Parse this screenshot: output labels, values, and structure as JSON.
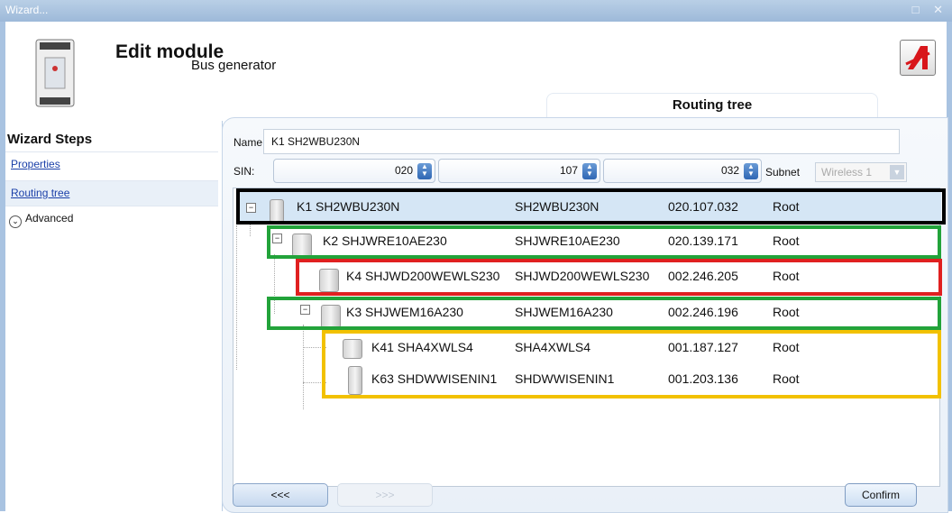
{
  "window": {
    "title": "Wizard...",
    "controls": "□ ✕"
  },
  "header": {
    "title": "Edit module",
    "subtitle": "Bus generator",
    "tab": "Routing tree"
  },
  "sidebar": {
    "title": "Wizard Steps",
    "items": [
      {
        "label": "Properties"
      },
      {
        "label": "Routing tree"
      },
      {
        "label": "Advanced"
      }
    ]
  },
  "form": {
    "name_label": "Name",
    "name_value": "K1 SH2WBU230N",
    "sin_label": "SIN:",
    "sin": [
      "020",
      "107",
      "032"
    ],
    "subnet_label": "Subnet",
    "subnet_value": "Wireless 1"
  },
  "tree": {
    "rows": [
      {
        "name": "K1 SH2WBU230N",
        "type": "SH2WBU230N",
        "address": "020.107.032",
        "route": "Root"
      },
      {
        "name": "K2 SHJWRE10AE230",
        "type": "SHJWRE10AE230",
        "address": "020.139.171",
        "route": "Root"
      },
      {
        "name": "K4 SHJWD200WEWLS230",
        "type": "SHJWD200WEWLS230",
        "address": "002.246.205",
        "route": "Root"
      },
      {
        "name": "K3 SHJWEM16A230",
        "type": "SHJWEM16A230",
        "address": "002.246.196",
        "route": "Root"
      },
      {
        "name": "K41 SHA4XWLS4",
        "type": "SHA4XWLS4",
        "address": "001.187.127",
        "route": "Root"
      },
      {
        "name": "K63 SHDWWISENIN1",
        "type": "SHDWWISENIN1",
        "address": "001.203.136",
        "route": "Root"
      }
    ]
  },
  "buttons": {
    "back": "<<<",
    "next": ">>>",
    "confirm": "Confirm"
  },
  "colors": {
    "black_box": "#000000",
    "green_box": "#22a33a",
    "red_box": "#e02020",
    "yellow_box": "#f2c100",
    "selected_row": "#d5e6f5"
  }
}
